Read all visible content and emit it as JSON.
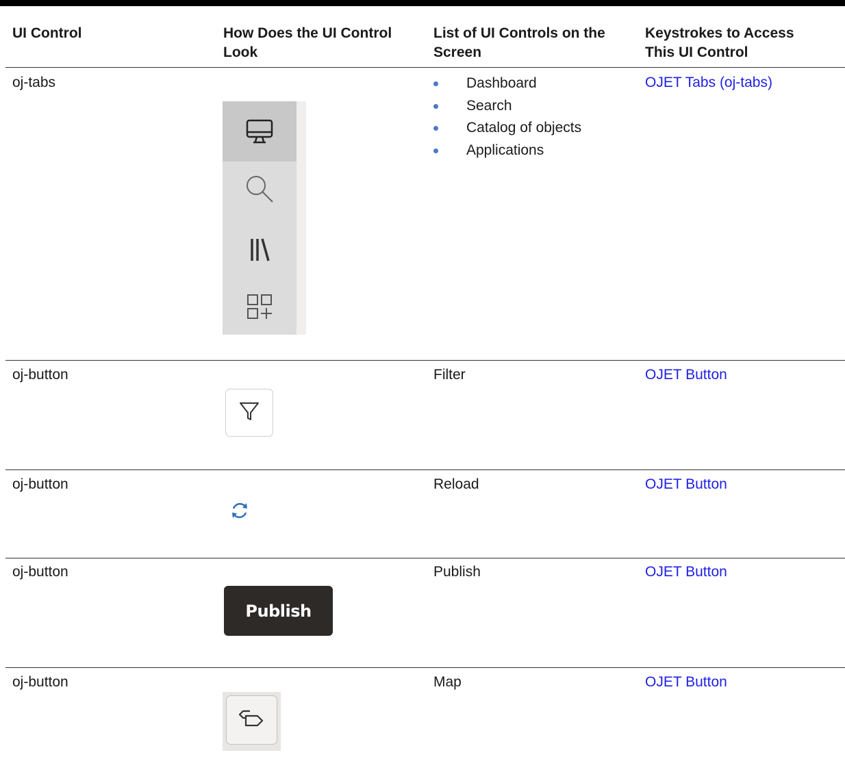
{
  "headers": {
    "col1": "UI Control",
    "col2_line1": "How Does the UI Control",
    "col2_line2": "Look",
    "col3_line1": "List of UI Controls on the",
    "col3_line2": "Screen",
    "col4_line1": "Keystrokes to Access",
    "col4_line2": "This UI Control"
  },
  "rows": [
    {
      "control": "oj-tabs",
      "items": [
        "Dashboard",
        "Search",
        "Catalog of objects",
        "Applications"
      ],
      "link": "OJET Tabs (oj-tabs)",
      "icons": [
        "monitor-icon",
        "search-icon",
        "library-icon",
        "add-grid-icon"
      ]
    },
    {
      "control": "oj-button",
      "list": "Filter",
      "link": "OJET Button",
      "icon": "filter-icon"
    },
    {
      "control": "oj-button",
      "list": "Reload",
      "link": "OJET Button",
      "icon": "reload-icon"
    },
    {
      "control": "oj-button",
      "list": "Publish",
      "link": "OJET Button",
      "button_label": "Publish"
    },
    {
      "control": "oj-button",
      "list": "Map",
      "link": "OJET Button",
      "icon": "map-icon"
    }
  ],
  "colors": {
    "link": "#1f1fe6",
    "bullet": "#4a78c9",
    "publish_bg": "#2e2a28"
  }
}
